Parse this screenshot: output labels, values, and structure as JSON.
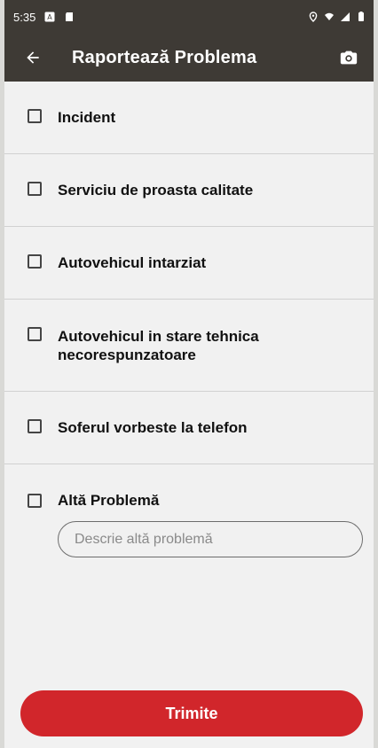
{
  "status_bar": {
    "time": "5:35",
    "left_icons": [
      "a-icon",
      "sd-card-icon"
    ],
    "right_icons": [
      "location-icon",
      "wifi-icon",
      "signal-icon",
      "battery-icon"
    ]
  },
  "app_bar": {
    "title": "Raportează Problema",
    "back_icon": "arrow-left-icon",
    "action_icon": "camera-icon"
  },
  "issues": [
    {
      "label": "Incident",
      "checked": false
    },
    {
      "label": "Serviciu de proasta calitate",
      "checked": false
    },
    {
      "label": "Autovehicul intarziat",
      "checked": false
    },
    {
      "label": "Autovehicul in stare tehnica necorespunzatoare",
      "checked": false
    },
    {
      "label": "Soferul vorbeste la telefon",
      "checked": false
    }
  ],
  "other_problem": {
    "label": "Altă Problemă",
    "checked": false,
    "placeholder": "Descrie altă problemă",
    "value": ""
  },
  "submit_label": "Trimite",
  "colors": {
    "header": "#3e3a35",
    "background": "#f1f1f1",
    "accent": "#d1262b",
    "divider": "#d1d1d1"
  }
}
